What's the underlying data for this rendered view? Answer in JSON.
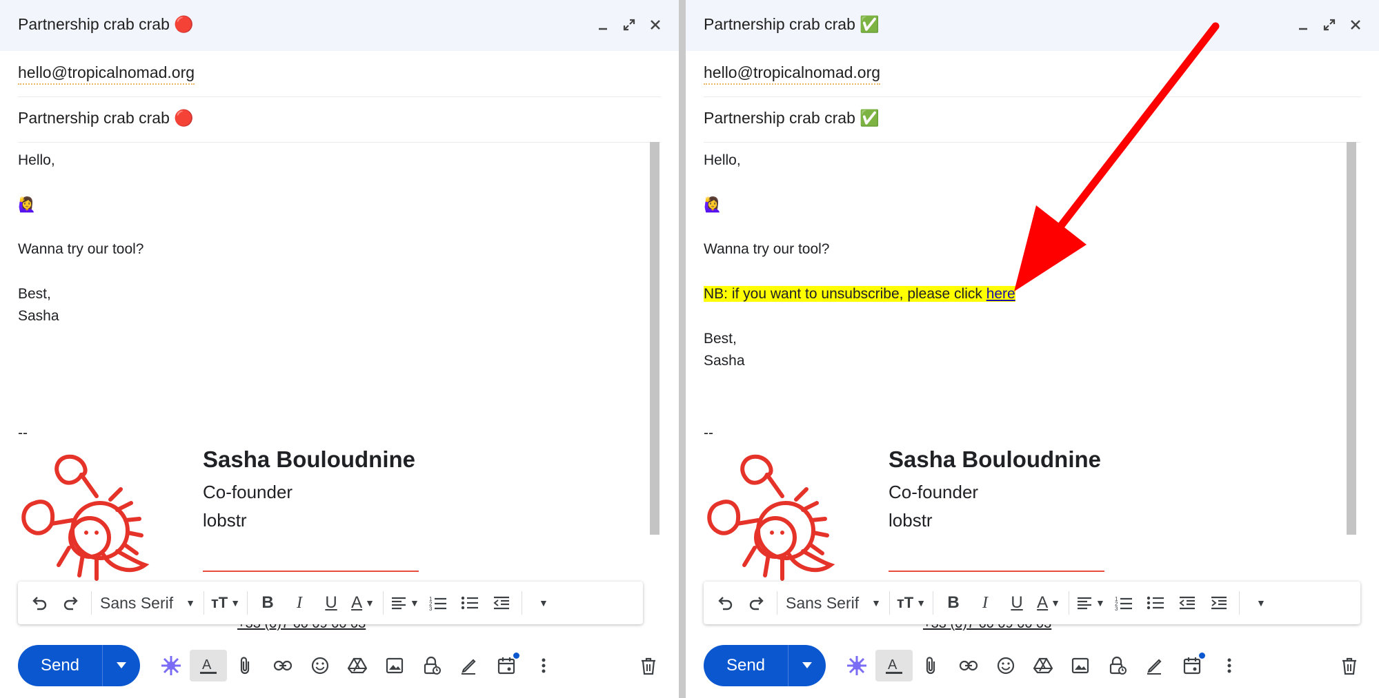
{
  "left": {
    "title": "Partnership crab crab 🔴",
    "to": "hello@tropicalnomad.org",
    "subject": "Partnership crab crab 🔴",
    "body": {
      "greeting": "Hello,",
      "emoji": "🙋‍♀️",
      "question": "Wanna try our tool?",
      "closing": "Best,",
      "name": "Sasha",
      "sig_sep": "--"
    }
  },
  "right": {
    "title": "Partnership crab crab ✅",
    "to": "hello@tropicalnomad.org",
    "subject": "Partnership crab crab ✅",
    "body": {
      "greeting": "Hello,",
      "emoji": "🙋‍♀️",
      "question": "Wanna try our tool?",
      "note": "NB: if you want to unsubscribe, please click ",
      "link": "here",
      "closing": "Best,",
      "name": "Sasha",
      "sig_sep": "--"
    }
  },
  "signature": {
    "name": "Sasha Bouloudnine",
    "role": "Co-founder",
    "company": "lobstr",
    "phone": "+33 (0)7 60 09 00 03"
  },
  "toolbar": {
    "font": "Sans Serif"
  },
  "send": {
    "label": "Send"
  },
  "icons": [
    "undo-icon",
    "redo-icon",
    "text-size-icon",
    "bold-icon",
    "italic-icon",
    "underline-icon",
    "text-color-icon",
    "align-icon",
    "numbered-list-icon",
    "bulleted-list-icon",
    "indent-less-icon",
    "indent-more-icon",
    "more-formatting-icon",
    "ai-sparkle-icon",
    "formatting-icon",
    "attach-icon",
    "link-icon",
    "emoji-icon",
    "drive-icon",
    "photo-icon",
    "confidential-icon",
    "signature-icon",
    "schedule-icon",
    "more-options-icon",
    "trash-icon"
  ],
  "colors": {
    "accent": "#0b57d0",
    "highlight": "#ffff00",
    "logo": "#e5332a",
    "arrow": "#ff0000"
  }
}
